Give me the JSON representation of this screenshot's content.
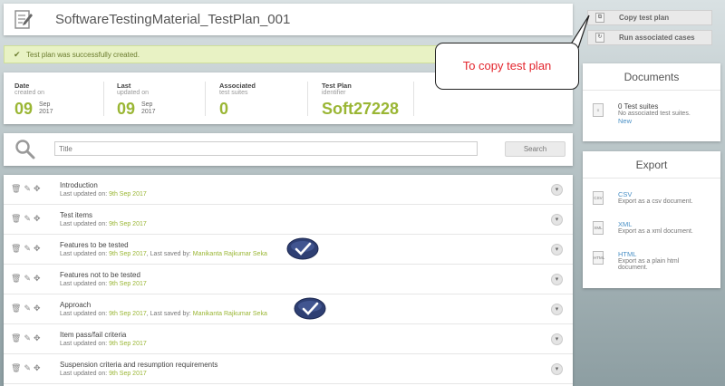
{
  "header": {
    "title": "SoftwareTestingMaterial_TestPlan_001"
  },
  "success": {
    "message": "Test plan was successfully created."
  },
  "stats": [
    {
      "label": "Date",
      "sub": "created on",
      "big": "09",
      "month": "Sep",
      "year": "2017"
    },
    {
      "label": "Last",
      "sub": "updated on",
      "big": "09",
      "month": "Sep",
      "year": "2017"
    },
    {
      "label": "Associated",
      "sub": "test suites",
      "big": "0"
    },
    {
      "label": "Test Plan",
      "sub": "identifier",
      "big": "Soft27228"
    }
  ],
  "search": {
    "placeholder": "Title",
    "button": "Search"
  },
  "rows": [
    {
      "title": "Introduction",
      "updated_prefix": "Last updated on:",
      "date": "9th Sep 2017",
      "saved_prefix": "",
      "saved_by": ""
    },
    {
      "title": "Test items",
      "updated_prefix": "Last updated on:",
      "date": "9th Sep 2017",
      "saved_prefix": "",
      "saved_by": ""
    },
    {
      "title": "Features to be tested",
      "updated_prefix": "Last updated on:",
      "date": "9th Sep 2017",
      "saved_prefix": ", Last saved by:",
      "saved_by": "Manikanta Rajkumar Seka"
    },
    {
      "title": "Features not to be tested",
      "updated_prefix": "Last updated on:",
      "date": "9th Sep 2017",
      "saved_prefix": "",
      "saved_by": ""
    },
    {
      "title": "Approach",
      "updated_prefix": "Last updated on:",
      "date": "9th Sep 2017",
      "saved_prefix": ", Last saved by:",
      "saved_by": "Manikanta Rajkumar Seka"
    },
    {
      "title": "Item pass/fail criteria",
      "updated_prefix": "Last updated on:",
      "date": "9th Sep 2017",
      "saved_prefix": "",
      "saved_by": ""
    },
    {
      "title": "Suspension criteria and resumption requirements",
      "updated_prefix": "Last updated on:",
      "date": "9th Sep 2017",
      "saved_prefix": "",
      "saved_by": ""
    }
  ],
  "actions": {
    "copy": "Copy test plan",
    "run": "Run associated cases"
  },
  "callout": {
    "text": "To copy test plan"
  },
  "documents": {
    "title": "Documents",
    "count": "0 Test suites",
    "desc": "No associated test suites.",
    "link": "New"
  },
  "export": {
    "title": "Export",
    "items": [
      {
        "icon": "CSV",
        "label": "CSV",
        "desc": "Export as a csv document."
      },
      {
        "icon": "XML",
        "label": "XML",
        "desc": "Export as a xml document."
      },
      {
        "icon": "HTML",
        "label": "HTML",
        "desc": "Export as a plain html document."
      }
    ]
  },
  "colors": {
    "accent_green": "#9ab634",
    "link_blue": "#4a90c6",
    "callout_red": "#e3252d"
  }
}
